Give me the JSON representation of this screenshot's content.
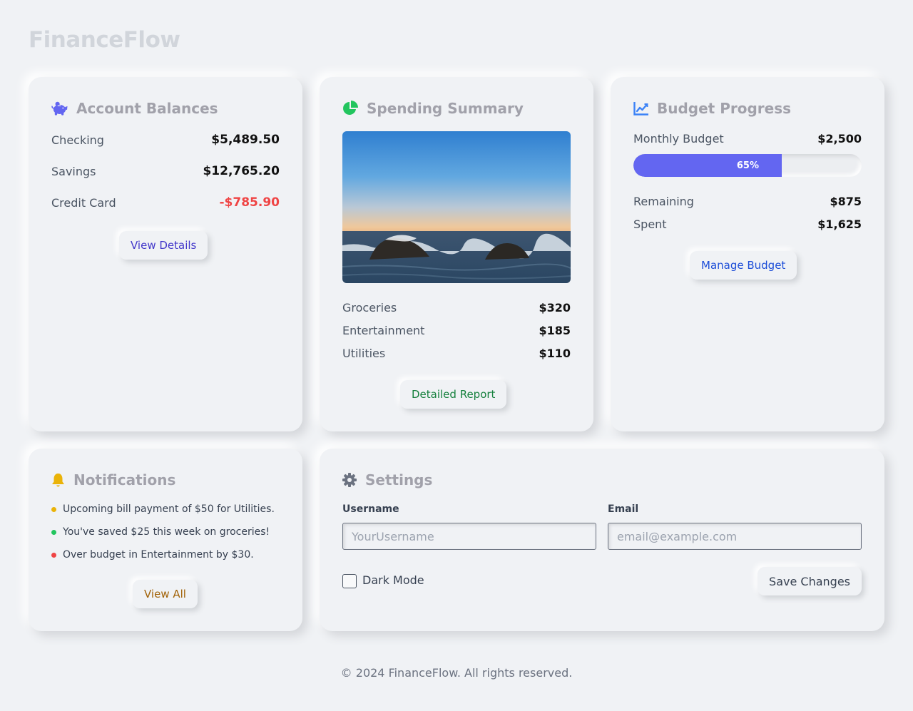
{
  "app": {
    "brand": "FinanceFlow"
  },
  "accounts": {
    "title": "Account Balances",
    "icon": "piggy-bank-icon",
    "items": [
      {
        "label": "Checking",
        "value": "$5,489.50",
        "negative": false
      },
      {
        "label": "Savings",
        "value": "$12,765.20",
        "negative": false
      },
      {
        "label": "Credit Card",
        "value": "-$785.90",
        "negative": true
      }
    ],
    "button_label": "View Details",
    "button_color": "#4338ca"
  },
  "spending": {
    "title": "Spending Summary",
    "icon": "pie-chart-icon",
    "items": [
      {
        "label": "Groceries",
        "value": "$320"
      },
      {
        "label": "Entertainment",
        "value": "$185"
      },
      {
        "label": "Utilities",
        "value": "$110"
      }
    ],
    "button_label": "Detailed Report",
    "button_color": "#15803d"
  },
  "budget": {
    "title": "Budget Progress",
    "icon": "line-chart-icon",
    "monthly_label": "Monthly Budget",
    "monthly_value": "$2,500",
    "progress_percent": 65,
    "progress_label": "65%",
    "items": [
      {
        "label": "Remaining",
        "value": "$875"
      },
      {
        "label": "Spent",
        "value": "$1,625"
      }
    ],
    "button_label": "Manage Budget",
    "button_color": "#1d4ed8",
    "accent": "#6366f1"
  },
  "notifications": {
    "title": "Notifications",
    "icon": "bell-icon",
    "items": [
      {
        "text": "Upcoming bill payment of $50 for Utilities.",
        "color": "#eab308"
      },
      {
        "text": "You've saved $25 this week on groceries!",
        "color": "#22c55e"
      },
      {
        "text": "Over budget in Entertainment by $30.",
        "color": "#ef4444"
      }
    ],
    "button_label": "View All",
    "button_color": "#a16207"
  },
  "settings": {
    "title": "Settings",
    "icon": "gear-icon",
    "username_label": "Username",
    "username_placeholder": "YourUsername",
    "email_label": "Email",
    "email_placeholder": "email@example.com",
    "dark_mode_label": "Dark Mode",
    "dark_mode_checked": false,
    "save_label": "Save Changes"
  },
  "footer": {
    "text": "© 2024 FinanceFlow. All rights reserved."
  }
}
